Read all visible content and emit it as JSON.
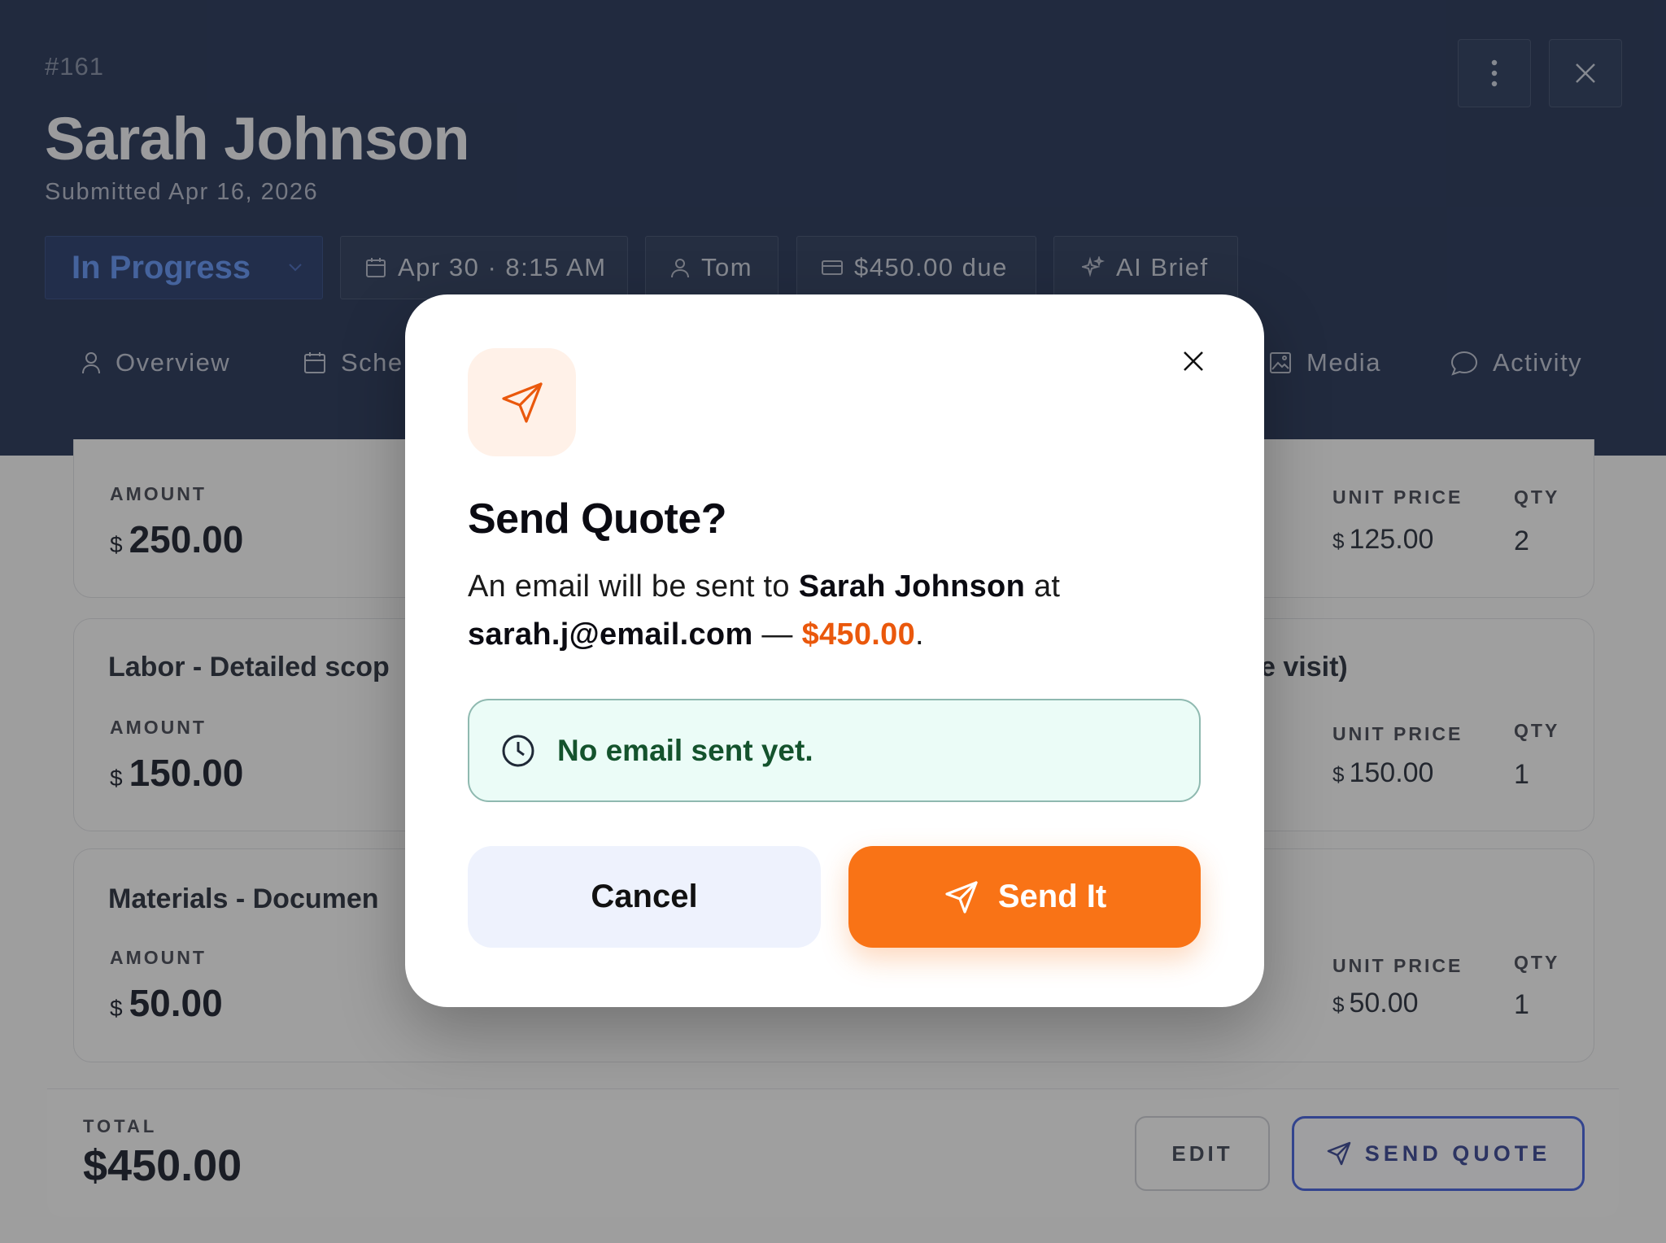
{
  "record": {
    "id": "#161",
    "name": "Sarah Johnson",
    "submitted": "Submitted Apr 16, 2026"
  },
  "header_actions": {
    "more_icon": "more-vertical-icon",
    "close_icon": "close-icon"
  },
  "chips": {
    "status": "In Progress",
    "schedule": "Apr 30 · 8:15 AM",
    "assignee": "Tom",
    "balance": "$450.00 due",
    "ai": "AI Brief"
  },
  "tabs": {
    "overview": "Overview",
    "schedule": "Sche",
    "media": "Media",
    "activity": "Activity"
  },
  "line_items": [
    {
      "title": "",
      "amount_label": "AMOUNT",
      "currency": "$",
      "amount": "250.00",
      "unit_price_label": "UNIT PRICE",
      "unit_price": "125.00",
      "qty_label": "QTY",
      "qty": "2"
    },
    {
      "title": "Labor - Detailed scop",
      "title_tail": "e visit)",
      "amount_label": "AMOUNT",
      "currency": "$",
      "amount": "150.00",
      "unit_price_label": "UNIT PRICE",
      "unit_price": "150.00",
      "qty_label": "QTY",
      "qty": "1"
    },
    {
      "title": "Materials - Documen",
      "amount_label": "AMOUNT",
      "currency": "$",
      "amount": "50.00",
      "unit_price_label": "UNIT PRICE",
      "unit_price": "50.00",
      "qty_label": "QTY",
      "qty": "1"
    }
  ],
  "footer": {
    "total_label": "TOTAL",
    "total": "$450.00",
    "edit": "EDIT",
    "send_quote": "SEND QUOTE"
  },
  "modal": {
    "icon": "send-icon",
    "title": "Send Quote?",
    "body_prefix": "An email will be sent to ",
    "recipient_name": "Sarah Johnson",
    "body_at": " at",
    "recipient_email": "sarah.j@email.com",
    "dash": " — ",
    "amount": "$450.00",
    "period": ".",
    "status_text": "No email sent yet.",
    "cancel": "Cancel",
    "send": "Send It",
    "accent": "#f97316"
  }
}
